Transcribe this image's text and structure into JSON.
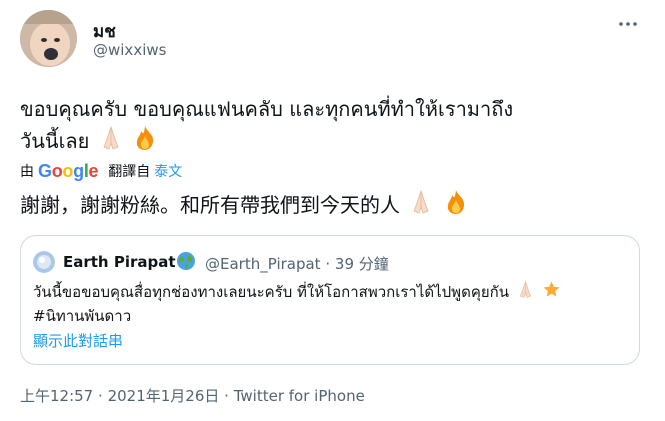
{
  "author": {
    "display_name": "มช",
    "handle": "@wixxiws"
  },
  "tweet": {
    "line1": "ขอบคุณครับ ขอบคุณแฟนคลับ และทุกคนที่ทำให้เรามาถึง",
    "line2": "วันนี้เลย",
    "emojis": [
      "folded-hands-light-skin",
      "fire"
    ]
  },
  "translation": {
    "by_label": "由",
    "provider": "Google",
    "translated_from_label": "翻譯自",
    "source_language": "泰文",
    "text": "謝謝，謝謝粉絲。和所有帶我們到今天的人"
  },
  "quote": {
    "display_name": "Earth Pirapat",
    "handle": "@Earth_Pirapat",
    "separator": "·",
    "time": "39 分鐘",
    "text_line1": "วันนี้ขอขอบคุณสื่อทุกช่องทางเลยนะครับ ที่ให้โอกาสพวกเราได้ไปพูดคุยกัน",
    "hashtag": "#นิทานพันดาว",
    "show_thread": "顯示此對話串"
  },
  "footer": {
    "time": "上午12:57",
    "separator": "·",
    "date": "2021年1月26日",
    "source": "Twitter for iPhone"
  },
  "colors": {
    "link": "#1d9bf0",
    "secondary_text": "#536471",
    "border": "#cfd9de"
  }
}
